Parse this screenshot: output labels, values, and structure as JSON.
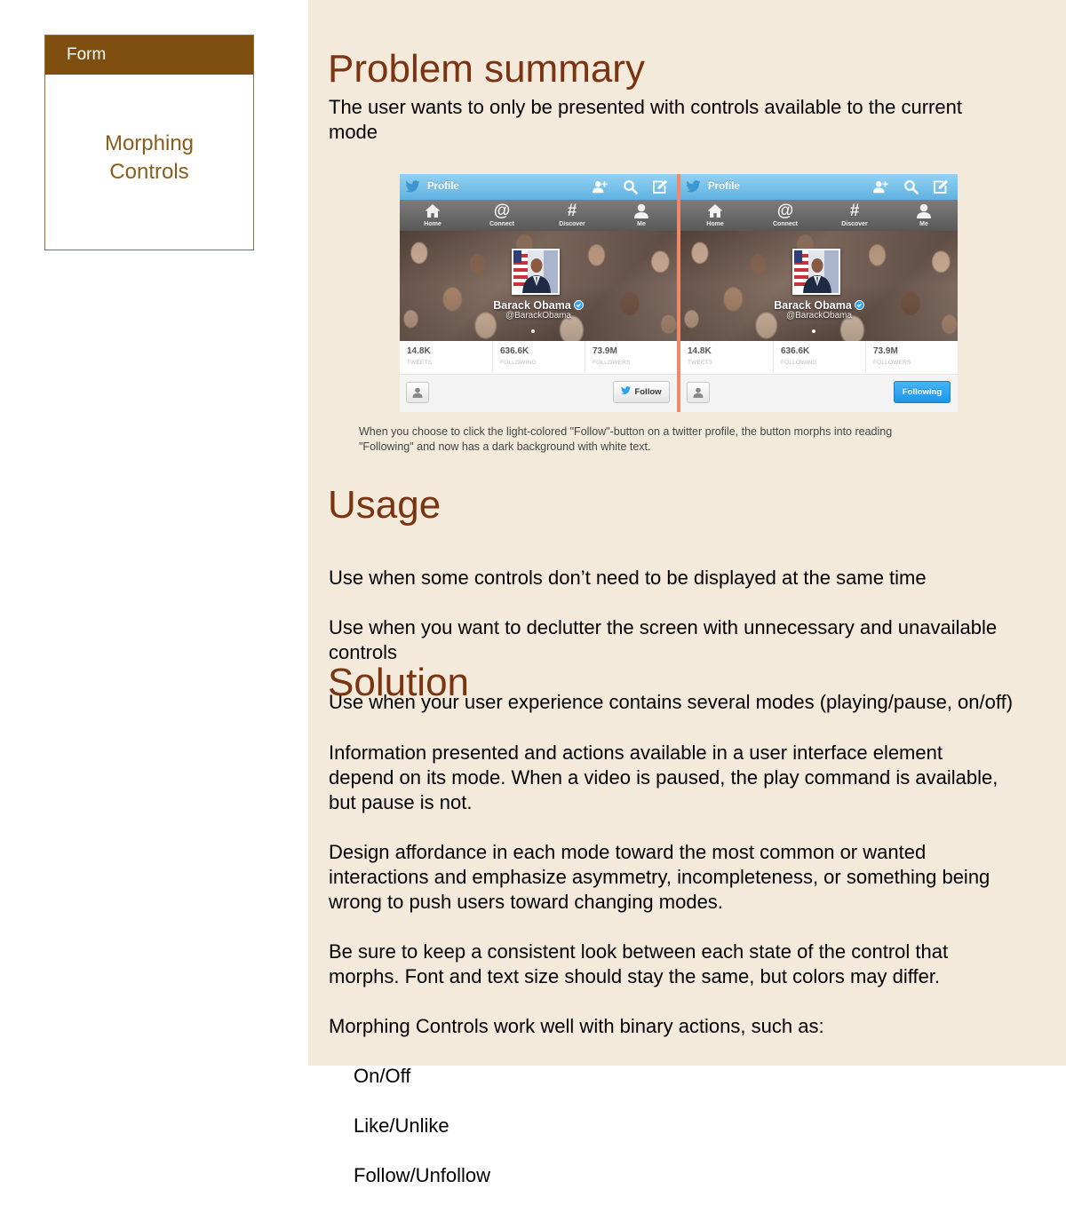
{
  "sidebar": {
    "card_header": "Form",
    "card_title_line1": "Morphing",
    "card_title_line2": "Controls"
  },
  "problem": {
    "heading": "Problem summary",
    "body": "The user wants to only be presented with controls available to the current\nmode"
  },
  "figure": {
    "panels": [
      {
        "topbar_title": "Profile",
        "nav": [
          "Home",
          "Connect",
          "Discover",
          "Me"
        ],
        "name": "Barack Obama",
        "handle": "@BarackObama",
        "stats": [
          {
            "value": "14.8K",
            "label": "TWEETS"
          },
          {
            "value": "636.6K",
            "label": "FOLLOWING"
          },
          {
            "value": "73.9M",
            "label": "FOLLOWERS"
          }
        ],
        "action_label": "Follow"
      },
      {
        "topbar_title": "Profile",
        "nav": [
          "Home",
          "Connect",
          "Discover",
          "Me"
        ],
        "name": "Barack Obama",
        "handle": "@BarackObama",
        "stats": [
          {
            "value": "14.8K",
            "label": "TWEETS"
          },
          {
            "value": "636.6K",
            "label": "FOLLOWING"
          },
          {
            "value": "73.9M",
            "label": "FOLLOWERS"
          }
        ],
        "action_label": "Following"
      }
    ],
    "caption": "When you choose to click the light-colored \"Follow\"-button on a twitter profile, the button morphs into reading\n\"Following\" and now has a dark background with white text."
  },
  "usage": {
    "heading": "Usage",
    "lines": [
      "Use when some controls don’t need to be displayed at the same time",
      "Use when you want to declutter the screen with unnecessary and unavailable\ncontrols",
      "Use when your user experience contains several modes (playing/pause, on/off)"
    ]
  },
  "solution": {
    "heading": "Solution",
    "paragraphs": [
      "Information presented and actions available in a user interface element\ndepend on its mode. When a video is paused, the play command is available,\nbut pause is not.",
      "Design affordance in each mode toward the most common or wanted\ninteractions and emphasize asymmetry, incompleteness, or something being\nwrong to push users toward changing modes.",
      "Be sure to keep a consistent look between each state of the control that\nmorphs. Font and text size should stay the same, but colors may differ.",
      "Morphing Controls work well with binary actions, such as:"
    ],
    "list": [
      "On/Off",
      "Like/Unlike",
      "Follow/Unfollow"
    ]
  },
  "colors": {
    "heading": "#7a3412",
    "main_background": "#f3eadb",
    "card_header": "#7e4f0e",
    "card_title": "#8a5d1a",
    "follow_active": "#1d95e8",
    "separator": "#f0896a"
  }
}
